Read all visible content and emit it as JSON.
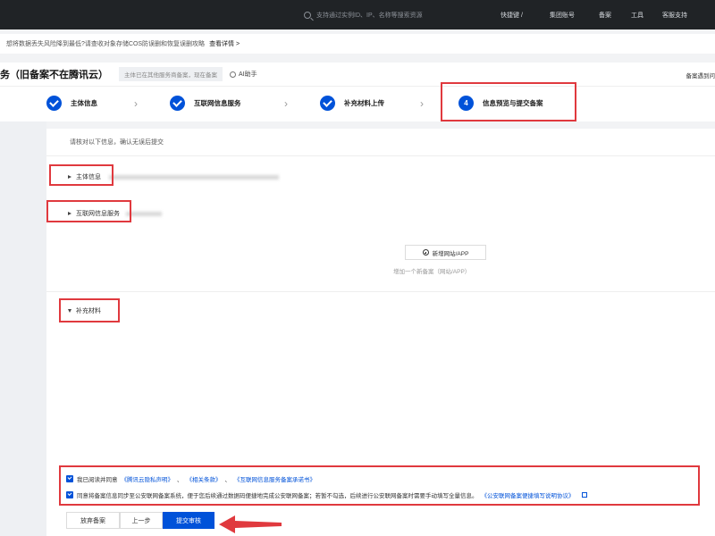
{
  "topbar": {
    "search_placeholder": "支持通过实例ID、IP、名称等搜索资源",
    "nav": [
      "快捷键 /",
      "集团账号",
      "备案",
      "工具",
      "客服支持"
    ]
  },
  "notice": {
    "text": "想将数据丢失风险降到最低?请查收对象存储COS防误删和恢复误删攻略",
    "link": "查看详情 >"
  },
  "header": {
    "title": "务（旧备案不在腾讯云）",
    "badge": "主体已在其他服务商备案，现在备案",
    "ai": "AI助手",
    "right": "备案遇到问"
  },
  "steps": [
    {
      "label": "主体信息",
      "number": ""
    },
    {
      "label": "互联网信息服务",
      "number": ""
    },
    {
      "label": "补充材料上传",
      "number": ""
    },
    {
      "label": "信息预览与提交备案",
      "number": "4"
    }
  ],
  "content": {
    "hint": "请核对以下信息，确认无误后提交",
    "sections": {
      "subject": "主体信息",
      "internet": "互联网信息服务",
      "supplement": "补充材料"
    },
    "add_site_label": "新增网站/APP",
    "add_site_hint": "增加一个新备案（网站/APP）"
  },
  "agreements": {
    "first_prefix": "我已阅读并同意",
    "first_links": [
      "《腾讯云隐私声明》",
      "《相关条款》",
      "《互联网信息服务备案承诺书》"
    ],
    "first_sep": "、",
    "second_text": "同意将备案信息同步至公安联网备案系统，便于您后续通过数据码便捷地完成公安联网备案；若暂不勾选，后续进行公安联网备案时需要手动填写全量信息。",
    "second_link": "《公安联网备案便捷填写说明协议》"
  },
  "buttons": {
    "abandon": "放弃备案",
    "prev": "上一步",
    "submit": "提交审核"
  },
  "colors": {
    "primary": "#0052d9",
    "highlight": "#e0393e",
    "topbar": "#202326"
  }
}
